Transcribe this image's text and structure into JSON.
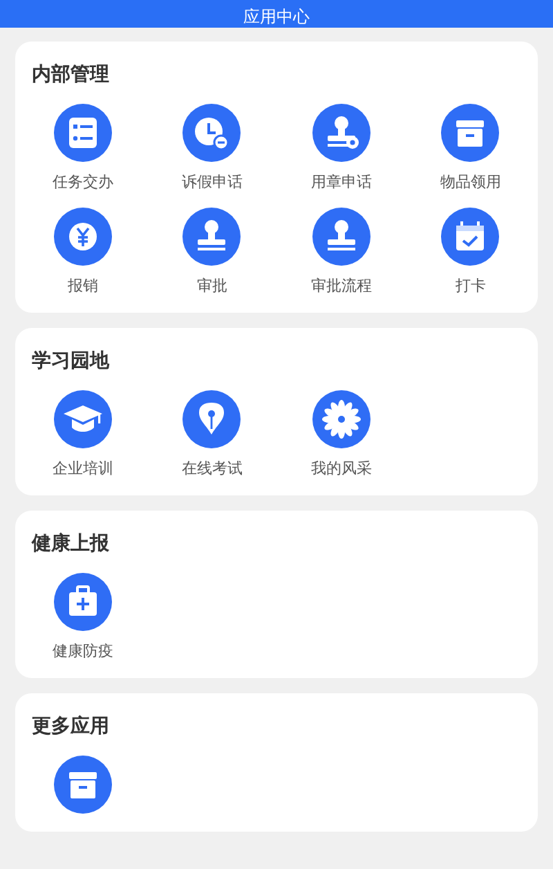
{
  "header": {
    "title": "应用中心"
  },
  "sections": [
    {
      "title": "内部管理",
      "items": [
        {
          "label": "任务交办",
          "kind": "checklist"
        },
        {
          "label": "诉假申话",
          "kind": "clock"
        },
        {
          "label": "用章申话",
          "kind": "stamp-gear"
        },
        {
          "label": "物品领用",
          "kind": "box"
        },
        {
          "label": "报销",
          "kind": "yen"
        },
        {
          "label": "审批",
          "kind": "stamp"
        },
        {
          "label": "审批流程",
          "kind": "stamp"
        },
        {
          "label": "打卡",
          "kind": "calendar"
        }
      ]
    },
    {
      "title": "学习园地",
      "items": [
        {
          "label": "企业培训",
          "kind": "cap"
        },
        {
          "label": "在线考试",
          "kind": "pen"
        },
        {
          "label": "我的风采",
          "kind": "flower"
        }
      ]
    },
    {
      "title": "健康上报",
      "items": [
        {
          "label": "健康防疫",
          "kind": "medkit"
        }
      ]
    },
    {
      "title": "更多应用",
      "items": [
        {
          "kind": "box"
        }
      ]
    }
  ]
}
